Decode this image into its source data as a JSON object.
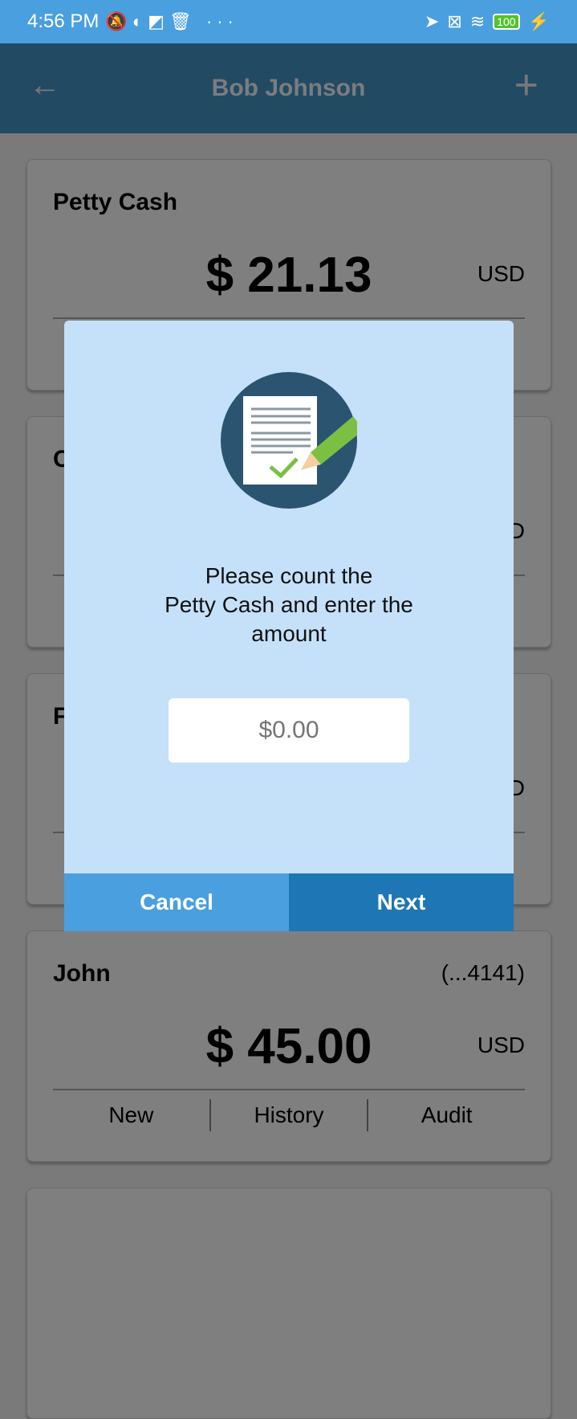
{
  "status_bar": {
    "time": "4:56 PM",
    "battery": "100"
  },
  "header": {
    "title": "Bob Johnson"
  },
  "cards": [
    {
      "name": "Petty Cash",
      "amount": "$ 21.13",
      "currency": "USD"
    },
    {
      "name": "C",
      "currency": "USD"
    },
    {
      "name": "F",
      "currency": "USD"
    },
    {
      "name": "John",
      "account": "(...4141)",
      "amount": "$ 45.00",
      "currency": "USD",
      "actions": [
        "New",
        "History",
        "Audit"
      ]
    }
  ],
  "dialog": {
    "message_lines": [
      "Please count the",
      "Petty Cash and enter the",
      "amount"
    ],
    "amount_placeholder": "$0.00",
    "cancel_label": "Cancel",
    "next_label": "Next"
  },
  "colors": {
    "status_bar": "#4a9fdf",
    "header": "#234a63",
    "dialog_bg": "#c5e1f9",
    "cancel": "#4a9fdf",
    "next": "#1e76b5"
  }
}
